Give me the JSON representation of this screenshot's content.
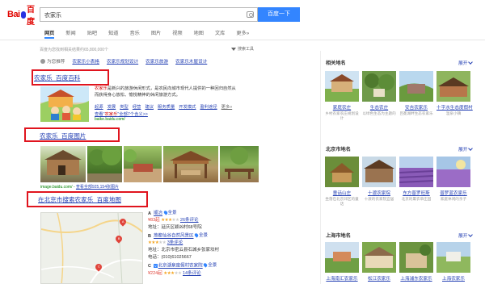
{
  "header": {
    "logo_du": "Bai",
    "logo_cn": "百度",
    "query": "农家乐",
    "search_button": "百度一下"
  },
  "tabs": [
    {
      "label": "网页",
      "active": true
    },
    {
      "label": "新闻",
      "active": false
    },
    {
      "label": "贴吧",
      "active": false
    },
    {
      "label": "知道",
      "active": false
    },
    {
      "label": "音乐",
      "active": false
    },
    {
      "label": "图片",
      "active": false
    },
    {
      "label": "视频",
      "active": false
    },
    {
      "label": "地图",
      "active": false
    },
    {
      "label": "文库",
      "active": false
    },
    {
      "label": "更多»",
      "active": false
    }
  ],
  "results_info": {
    "count_text": "百度为您找到相关结果约65,800,000个",
    "search_tools": "搜索工具"
  },
  "recommend": {
    "label": "为您推荐",
    "links": [
      "农家乐小表格",
      "农家乐规划设计",
      "农家乐旅游",
      "农家乐木屋设计"
    ]
  },
  "results": {
    "baike": {
      "title": "农家乐_百度百科",
      "desc_hl": "农家乐",
      "desc_rest": "是新兴的旅游休闲形式，是农民向城市现代人提供的一种回归自然从而获得身心放松、愉悦精神的休闲旅游方式。",
      "links": [
        "起源",
        "发展",
        "类型",
        "经营",
        "建议",
        "服务质量",
        "开发模式",
        "盈利途径"
      ],
      "more": "更多»",
      "link2_pre": "查看\"",
      "link2_hl": "农家乐",
      "link2_post": "\"全部7个含义>>",
      "url": "baike.baidu.com/"
    },
    "images": {
      "title": "农家乐_百度图片",
      "url": "image.baidu.com/",
      "caption_link": "查看全部925,154张图片",
      "sep": " - "
    },
    "map": {
      "title": "在北京市搜索农家乐_百度地图",
      "pois": [
        {
          "letter": "A",
          "name": "顺冶",
          "pano": "全景",
          "price": "¥83起",
          "stars": "★★★",
          "stars_off": "★★",
          "comments": "26条评论",
          "address": "地址：延庆区颖凶村68号院"
        },
        {
          "letter": "B",
          "name": "燕都仙谷自然风景区",
          "pano": "全景",
          "stars": "★★★",
          "stars_off": "★★",
          "comments": "3条评论",
          "address": "地址：北京市密云县石城乡张家坟村",
          "phone": "电话：(010)61025667"
        },
        {
          "letter": "C",
          "badge": "V",
          "name": "北京湖泉度假村农家院",
          "pano": "全景",
          "price": "¥224起",
          "stars": "★★★",
          "stars_off": "★★",
          "comments": "14条评论"
        }
      ]
    }
  },
  "sidebar": {
    "sections": [
      {
        "title": "相关地名",
        "expand": "展开",
        "cards": [
          {
            "name": "家庭农庄",
            "sub": "乡村农家农庄规划设计"
          },
          {
            "name": "生态农庄",
            "sub": "以绿色生态为主题的"
          },
          {
            "name": "安吉农家乐",
            "sub": "吕冕湖畔生态农家乐"
          },
          {
            "name": "十字水生态度假村",
            "sub": "温泉小镇"
          }
        ]
      },
      {
        "title": "北京市地名",
        "expand": "展开",
        "cards": [
          {
            "name": "童话山庄",
            "sub": "坐落在北京郊区的童话"
          },
          {
            "name": "十渡农家院",
            "sub": "十渡的农家院宜居"
          },
          {
            "name": "东方普罗旺斯",
            "sub": "北京的薰衣草庄园"
          },
          {
            "name": "普罗蓝农家乐",
            "sub": "家庭休闲的亲子"
          }
        ]
      },
      {
        "title": "上海市地名",
        "expand": "展开",
        "cards": [
          {
            "name": "上海南汇农家乐",
            "sub": ""
          },
          {
            "name": "松江农家乐",
            "sub": ""
          },
          {
            "name": "上海浦东农家乐",
            "sub": ""
          },
          {
            "name": "上海农家乐",
            "sub": ""
          }
        ]
      }
    ]
  }
}
